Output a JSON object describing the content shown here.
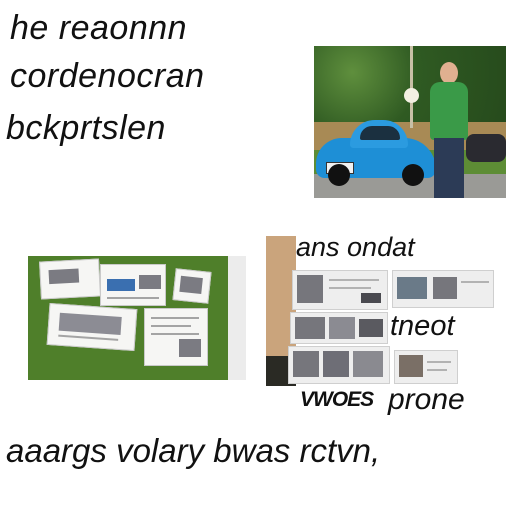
{
  "headline": {
    "line1": "he reaonnn",
    "line2": "cordenocran",
    "line3": "bckprtslen"
  },
  "middle": {
    "line1": "ans ondat",
    "line2": "tneot",
    "line3_small": "VWOES",
    "line3_large": "prone"
  },
  "bottom": {
    "line": "aaargs volary bwas rctvn,"
  },
  "colors": {
    "background": "#ffffff",
    "car": "#1e8fd6",
    "shirt": "#3a9a48",
    "grass": "#4f7f2a"
  }
}
